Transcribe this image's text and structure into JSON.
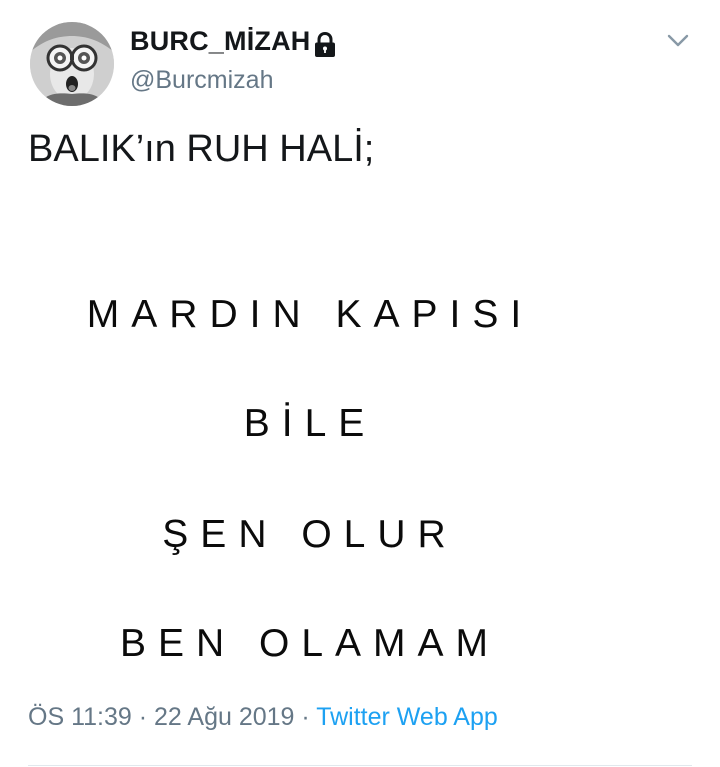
{
  "tweet": {
    "display_name": "BURC_MİZAH",
    "handle": "@Burcmizah",
    "icons": {
      "lock": "lock-icon",
      "caret": "chevron-down-icon",
      "avatar": "avatar"
    },
    "intro": "BALIK’ın RUH HALİ;",
    "lines": [
      "MARDIN KAPISI",
      "BİLE",
      "ŞEN OLUR",
      "BEN OLAMAM"
    ],
    "time": "ÖS 11:39",
    "separator1": "·",
    "date": "22 Ağu 2019",
    "separator2": "·",
    "source": "Twitter Web App"
  },
  "colors": {
    "text_primary": "#14171a",
    "text_secondary": "#657786",
    "link": "#1da1f2",
    "divider": "#e1e8ed"
  }
}
